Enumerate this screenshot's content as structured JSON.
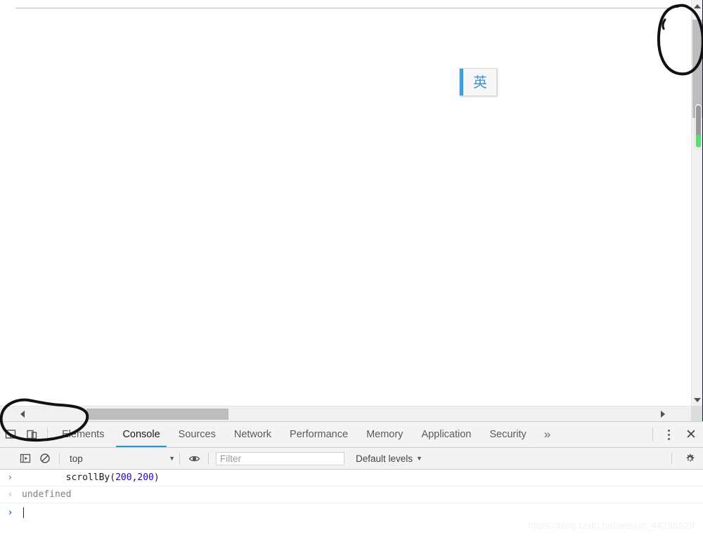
{
  "page": {
    "ime_indicator": {
      "glyph": "英",
      "accent_color": "#3aa0e0"
    },
    "vertical_scrollbar": {
      "up_arrow": "scroll-up-arrow",
      "down_arrow": "scroll-down-arrow",
      "thumb": "vertical-scroll-thumb",
      "drag_indicator_color": "#54e073"
    },
    "horizontal_scrollbar": {
      "left_arrow": "scroll-left-arrow",
      "right_arrow": "scroll-right-arrow",
      "thumb": "horizontal-scroll-thumb"
    }
  },
  "devtools": {
    "tabs": [
      {
        "label": "Elements",
        "active": false
      },
      {
        "label": "Console",
        "active": true
      },
      {
        "label": "Sources",
        "active": false
      },
      {
        "label": "Network",
        "active": false
      },
      {
        "label": "Performance",
        "active": false
      },
      {
        "label": "Memory",
        "active": false
      },
      {
        "label": "Application",
        "active": false
      },
      {
        "label": "Security",
        "active": false
      }
    ],
    "overflow_label": "»",
    "close_label": "✕",
    "toolbar": {
      "context": "top",
      "context_caret": "▼",
      "filter_placeholder": "Filter",
      "filter_value": "",
      "levels_label": "Default levels",
      "levels_caret": "▼"
    },
    "console": {
      "entries": [
        {
          "marker": "›",
          "type": "input",
          "segments": [
            {
              "text": "scrollBy(",
              "kind": "plain"
            },
            {
              "text": "200",
              "kind": "number"
            },
            {
              "text": ",",
              "kind": "plain"
            },
            {
              "text": "200",
              "kind": "number"
            },
            {
              "text": ")",
              "kind": "plain"
            }
          ]
        },
        {
          "marker": "‹",
          "type": "result",
          "text": "undefined"
        }
      ],
      "prompt_marker": "›",
      "prompt_value": ""
    }
  },
  "watermark": "https://blog.csdn.net/weixin_44296929",
  "accent_color": "#1a9de0"
}
